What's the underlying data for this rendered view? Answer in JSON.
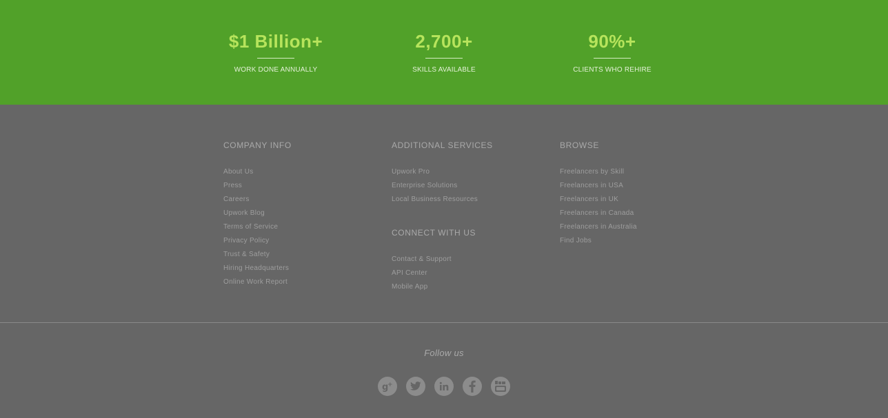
{
  "stats": [
    {
      "value": "$1 Billion+",
      "label": "WORK DONE ANNUALLY"
    },
    {
      "value": "2,700+",
      "label": "SKILLS AVAILABLE"
    },
    {
      "value": "90%+",
      "label": "CLIENTS WHO REHIRE"
    }
  ],
  "footer": {
    "company_info": {
      "heading": "COMPANY INFO",
      "links": [
        "About Us",
        "Press",
        "Careers",
        "Upwork Blog",
        "Terms of Service",
        "Privacy Policy",
        "Trust & Safety",
        "Hiring Headquarters",
        "Online Work Report"
      ]
    },
    "additional_services": {
      "heading": "ADDITIONAL SERVICES",
      "links": [
        "Upwork Pro",
        "Enterprise Solutions",
        "Local Business Resources"
      ]
    },
    "connect": {
      "heading": "CONNECT WITH US",
      "links": [
        "Contact & Support",
        "API Center",
        "Mobile App"
      ]
    },
    "browse": {
      "heading": "BROWSE",
      "links": [
        "Freelancers by Skill",
        "Freelancers in USA",
        "Freelancers in UK",
        "Freelancers in Canada",
        "Freelancers in Australia",
        "Find Jobs"
      ]
    },
    "follow_label": "Follow us",
    "social": [
      "google-plus-icon",
      "twitter-icon",
      "linkedin-icon",
      "facebook-icon",
      "youtube-icon"
    ]
  },
  "colors": {
    "stats_bg": "#51a129",
    "stat_value": "#b7e45c",
    "footer_bg": "#666666"
  }
}
